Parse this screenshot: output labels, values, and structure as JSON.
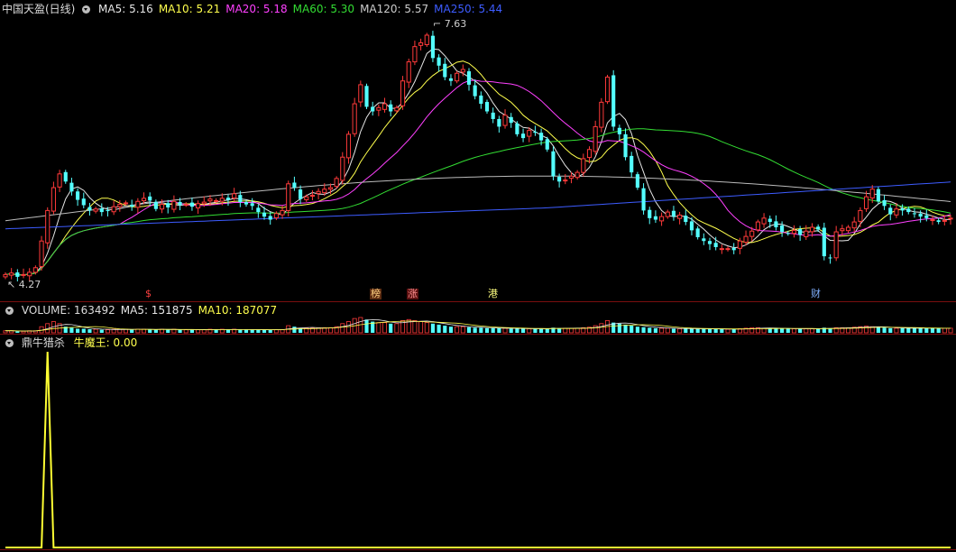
{
  "app": {
    "colors": {
      "bg": "#000000",
      "up": "#ff3a3a",
      "down": "#54ffff",
      "grid": "#7a0f0f",
      "text": "#c8c8c8"
    }
  },
  "price_header": {
    "title": "中国天盈(日线)",
    "items": [
      {
        "label": "MA5: 5.16",
        "color": "#e6e6e6"
      },
      {
        "label": "MA10: 5.21",
        "color": "#ffff4d"
      },
      {
        "label": "MA20: 5.18",
        "color": "#ff40ff"
      },
      {
        "label": "MA60: 5.30",
        "color": "#33dd33"
      },
      {
        "label": "MA120: 5.57",
        "color": "#cccccc"
      },
      {
        "label": "MA250: 5.44",
        "color": "#3d5cff"
      }
    ]
  },
  "volume_header": {
    "items": [
      {
        "label": "VOLUME: 163492",
        "color": "#dcdcdc"
      },
      {
        "label": "MA5: 151875",
        "color": "#e6e6e6"
      },
      {
        "label": "MA10: 187077",
        "color": "#ffff4d"
      }
    ]
  },
  "indicator_header": {
    "title": "鼎牛猎杀",
    "items": [
      {
        "label": "牛魔王: 0.00",
        "color": "#ffff4d"
      }
    ]
  },
  "annotations": {
    "high": "7.63",
    "low": "4.27"
  },
  "event_tags": [
    {
      "text": "$",
      "color": "#ff4040",
      "fill": "none"
    },
    {
      "text": "榜",
      "color": "#ffd080",
      "fill": "#5a2a10"
    },
    {
      "text": "涨",
      "color": "#ff9090",
      "fill": "#5a1010"
    },
    {
      "text": "港",
      "color": "#ffff80",
      "fill": "none"
    },
    {
      "text": "财",
      "color": "#80b0ff",
      "fill": "none"
    }
  ],
  "chart_data": {
    "type": "candlestick",
    "ylim": [
      4.27,
      7.63
    ],
    "close": [
      4.36,
      4.38,
      4.33,
      4.36,
      4.39,
      4.45,
      4.8,
      5.2,
      5.5,
      5.68,
      5.58,
      5.45,
      5.34,
      5.27,
      5.2,
      5.22,
      5.18,
      5.2,
      5.25,
      5.28,
      5.3,
      5.25,
      5.32,
      5.36,
      5.33,
      5.22,
      5.28,
      5.24,
      5.32,
      5.27,
      5.28,
      5.25,
      5.29,
      5.31,
      5.35,
      5.33,
      5.36,
      5.34,
      5.42,
      5.31,
      5.28,
      5.26,
      5.18,
      5.12,
      5.08,
      5.16,
      5.2,
      5.55,
      5.5,
      5.35,
      5.38,
      5.4,
      5.45,
      5.48,
      5.5,
      5.62,
      5.9,
      6.2,
      6.6,
      6.85,
      6.56,
      6.5,
      6.55,
      6.6,
      6.5,
      6.55,
      6.9,
      7.15,
      7.35,
      7.4,
      7.5,
      7.2,
      7.1,
      6.95,
      6.9,
      7.0,
      7.05,
      6.85,
      6.7,
      6.6,
      6.5,
      6.4,
      6.3,
      6.45,
      6.35,
      6.2,
      6.15,
      6.25,
      6.22,
      6.12,
      6.0,
      5.65,
      5.58,
      5.6,
      5.65,
      5.7,
      5.88,
      6.0,
      6.3,
      6.62,
      6.95,
      6.3,
      6.2,
      5.9,
      5.7,
      5.5,
      5.2,
      5.1,
      5.08,
      5.12,
      5.18,
      5.12,
      5.14,
      5.05,
      4.94,
      4.85,
      4.8,
      4.76,
      4.72,
      4.7,
      4.7,
      4.68,
      4.8,
      4.86,
      4.93,
      5.05,
      5.1,
      5.05,
      4.98,
      4.92,
      4.9,
      4.94,
      4.88,
      4.93,
      4.98,
      4.95,
      4.6,
      4.58,
      4.92,
      4.96,
      4.98,
      5.05,
      5.2,
      5.38,
      5.48,
      5.32,
      5.26,
      5.15,
      5.22,
      5.2,
      5.18,
      5.16,
      5.12,
      5.1,
      5.08,
      5.05,
      5.07,
      5.1
    ]
  },
  "volume_data": {
    "values": [
      0.2,
      0.2,
      0.15,
      0.15,
      0.2,
      0.2,
      0.6,
      0.9,
      1.1,
      0.9,
      0.6,
      0.5,
      0.4,
      0.4,
      0.35,
      0.35,
      0.3,
      0.3,
      0.35,
      0.35,
      0.35,
      0.3,
      0.35,
      0.35,
      0.35,
      0.3,
      0.35,
      0.3,
      0.35,
      0.3,
      0.3,
      0.3,
      0.3,
      0.3,
      0.35,
      0.3,
      0.35,
      0.3,
      0.35,
      0.3,
      0.3,
      0.3,
      0.3,
      0.3,
      0.3,
      0.3,
      0.3,
      0.7,
      0.6,
      0.45,
      0.45,
      0.45,
      0.5,
      0.5,
      0.5,
      0.6,
      0.9,
      1.1,
      1.4,
      1.5,
      1.3,
      1.1,
      1.0,
      1.0,
      0.9,
      0.9,
      1.2,
      1.3,
      1.2,
      1.1,
      1.0,
      0.9,
      0.8,
      0.7,
      0.6,
      0.6,
      0.6,
      0.55,
      0.5,
      0.5,
      0.45,
      0.45,
      0.45,
      0.45,
      0.4,
      0.4,
      0.4,
      0.4,
      0.4,
      0.4,
      0.4,
      0.5,
      0.45,
      0.45,
      0.45,
      0.45,
      0.5,
      0.55,
      0.7,
      0.9,
      1.2,
      1.0,
      0.9,
      0.8,
      0.7,
      0.6,
      0.55,
      0.5,
      0.45,
      0.45,
      0.45,
      0.4,
      0.4,
      0.4,
      0.4,
      0.4,
      0.4,
      0.4,
      0.35,
      0.35,
      0.35,
      0.35,
      0.4,
      0.45,
      0.5,
      0.5,
      0.45,
      0.45,
      0.4,
      0.4,
      0.4,
      0.4,
      0.4,
      0.4,
      0.4,
      0.4,
      0.5,
      0.45,
      0.5,
      0.5,
      0.5,
      0.55,
      0.6,
      0.65,
      0.6,
      0.55,
      0.5,
      0.45,
      0.45,
      0.45,
      0.45,
      0.45,
      0.45,
      0.45,
      0.45,
      0.45,
      0.45,
      0.45
    ]
  },
  "indicator_data": {
    "spike_index": 7,
    "max": 1.0
  }
}
